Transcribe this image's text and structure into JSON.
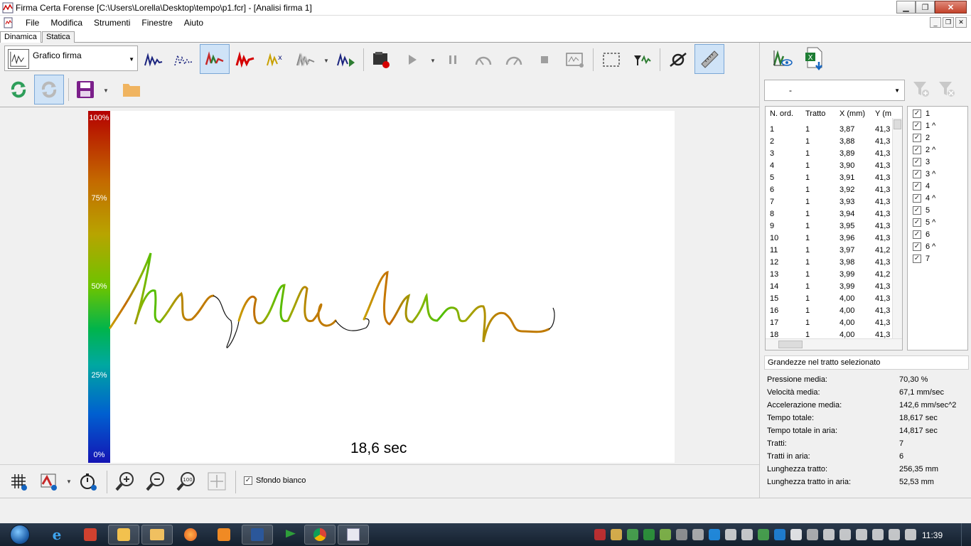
{
  "window": {
    "title": "Firma Certa Forense [C:\\Users\\Lorella\\Desktop\\tempo\\p1.fcr] - [Analisi firma 1]"
  },
  "menu": [
    "File",
    "Modifica",
    "Strumenti",
    "Finestre",
    "Aiuto"
  ],
  "tabs": [
    "Dinamica",
    "Statica"
  ],
  "toolbar": {
    "chart_selector": "Grafico firma"
  },
  "canvas": {
    "scale_labels": [
      "100%",
      "75%",
      "50%",
      "25%",
      "0%"
    ],
    "time_label": "18,6 sec"
  },
  "bottom_toolbar": {
    "white_background_label": "Sfondo bianco",
    "white_background_checked": true
  },
  "right_panel": {
    "filter_value": "-",
    "table": {
      "columns": [
        "N. ord.",
        "Tratto",
        "X (mm)",
        "Y (m"
      ],
      "rows": [
        [
          "1",
          "1",
          "3,87",
          "41,3"
        ],
        [
          "2",
          "1",
          "3,88",
          "41,3"
        ],
        [
          "3",
          "1",
          "3,89",
          "41,3"
        ],
        [
          "4",
          "1",
          "3,90",
          "41,3"
        ],
        [
          "5",
          "1",
          "3,91",
          "41,3"
        ],
        [
          "6",
          "1",
          "3,92",
          "41,3"
        ],
        [
          "7",
          "1",
          "3,93",
          "41,3"
        ],
        [
          "8",
          "1",
          "3,94",
          "41,3"
        ],
        [
          "9",
          "1",
          "3,95",
          "41,3"
        ],
        [
          "10",
          "1",
          "3,96",
          "41,3"
        ],
        [
          "11",
          "1",
          "3,97",
          "41,2"
        ],
        [
          "12",
          "1",
          "3,98",
          "41,3"
        ],
        [
          "13",
          "1",
          "3,99",
          "41,2"
        ],
        [
          "14",
          "1",
          "3,99",
          "41,3"
        ],
        [
          "15",
          "1",
          "4,00",
          "41,3"
        ],
        [
          "16",
          "1",
          "4,00",
          "41,3"
        ],
        [
          "17",
          "1",
          "4,00",
          "41,3"
        ],
        [
          "18",
          "1",
          "4,00",
          "41,3"
        ]
      ]
    },
    "strokes": [
      "1",
      "1 ^",
      "2",
      "2 ^",
      "3",
      "3 ^",
      "4",
      "4 ^",
      "5",
      "5 ^",
      "6",
      "6 ^",
      "7"
    ],
    "section_title": "Grandezze nel tratto selezionato",
    "stats": [
      {
        "label": "Pressione media:",
        "value": "70,30 %"
      },
      {
        "label": "Velocità media:",
        "value": "67,1 mm/sec"
      },
      {
        "label": "Accelerazione media:",
        "value": "142,6 mm/sec^2"
      },
      {
        "label": "Tempo totale:",
        "value": "18,617 sec"
      },
      {
        "label": "Tempo totale in aria:",
        "value": "14,817 sec"
      },
      {
        "label": "Tratti:",
        "value": "7"
      },
      {
        "label": "Tratti in aria:",
        "value": "6"
      },
      {
        "label": "Lunghezza tratto:",
        "value": "256,35 mm"
      },
      {
        "label": "Lunghezza tratto in aria:",
        "value": "52,53 mm"
      }
    ]
  },
  "taskbar": {
    "clock": "11:39"
  }
}
